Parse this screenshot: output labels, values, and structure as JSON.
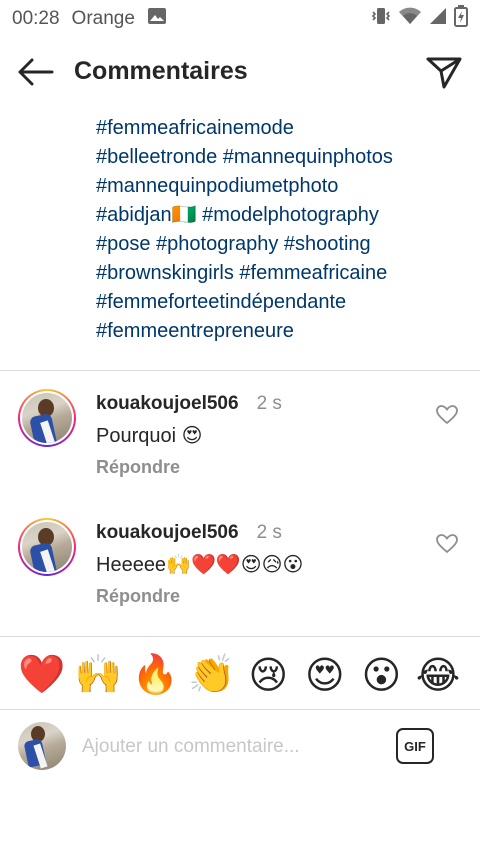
{
  "status_bar": {
    "time": "00:28",
    "carrier": "Orange",
    "icons": [
      "image-icon",
      "vibrate-icon",
      "wifi-icon",
      "signal-icon",
      "battery-icon"
    ]
  },
  "header": {
    "title": "Commentaires",
    "back_icon": "arrow-left-icon",
    "send_icon": "paper-plane-icon"
  },
  "caption": {
    "lines": [
      "#femmeafricainemode",
      "#belleetronde #mannequinphotos",
      "#mannequinpodiumetphoto",
      "#abidjan🇨🇮 #modelphotography",
      "#pose #photography #shooting",
      "#brownskingirls #femmeafricaine",
      "#femmeforteetindépendante",
      "#femmeentrepreneure"
    ]
  },
  "comments": [
    {
      "username": "kouakoujoel506",
      "time": "2 s",
      "text": "Pourquoi 😍",
      "reply": "Répondre"
    },
    {
      "username": "kouakoujoel506",
      "time": "2 s",
      "text": "Heeeee🙌❤️❤️😍😥😮",
      "reply": "Répondre"
    }
  ],
  "emoji_bar": [
    "❤️",
    "🙌",
    "🔥",
    "👏",
    "😢",
    "😍",
    "😮",
    "😂"
  ],
  "composer": {
    "placeholder": "Ajouter un commentaire...",
    "gif_label": "GIF"
  },
  "colors": {
    "hashtag": "#00376b",
    "text": "#262626",
    "muted": "#8e8e8e",
    "divider": "#dbdbdb"
  }
}
